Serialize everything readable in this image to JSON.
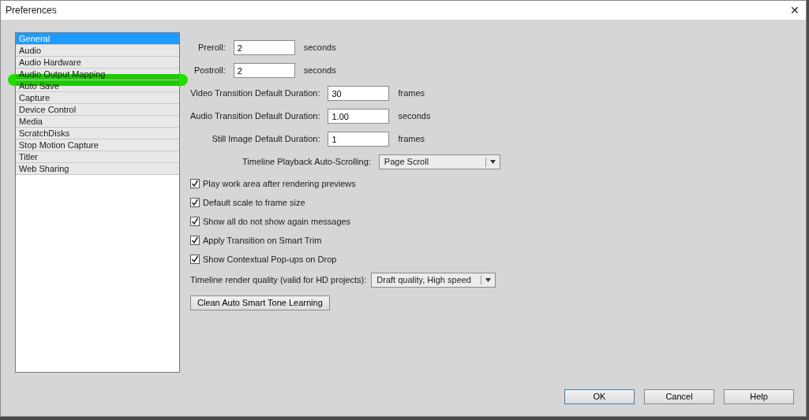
{
  "window": {
    "title": "Preferences",
    "close": "✕"
  },
  "sidebar": {
    "items": [
      {
        "label": "General",
        "selected": true,
        "highlighted": false
      },
      {
        "label": "Audio",
        "selected": false,
        "highlighted": false
      },
      {
        "label": "Audio Hardware",
        "selected": false,
        "highlighted": false
      },
      {
        "label": "Audio Output Mapping",
        "selected": false,
        "highlighted": true
      },
      {
        "label": "Auto Save",
        "selected": false,
        "highlighted": false
      },
      {
        "label": "Capture",
        "selected": false,
        "highlighted": false
      },
      {
        "label": "Device Control",
        "selected": false,
        "highlighted": false
      },
      {
        "label": "Media",
        "selected": false,
        "highlighted": false
      },
      {
        "label": "ScratchDisks",
        "selected": false,
        "highlighted": false
      },
      {
        "label": "Stop Motion Capture",
        "selected": false,
        "highlighted": false
      },
      {
        "label": "Titler",
        "selected": false,
        "highlighted": false
      },
      {
        "label": "Web Sharing",
        "selected": false,
        "highlighted": false
      }
    ]
  },
  "field_groups": [
    {
      "fields": [
        {
          "kind": "text",
          "label": "Preroll:",
          "value": "2",
          "unit": "seconds"
        },
        {
          "kind": "text",
          "label": "Postroll:",
          "value": "2",
          "unit": "seconds"
        }
      ]
    },
    {
      "fields": [
        {
          "kind": "text",
          "label": "Video Transition Default Duration:",
          "value": "30",
          "unit": "frames"
        },
        {
          "kind": "text",
          "label": "Audio Transition Default Duration:",
          "value": "1.00",
          "unit": "seconds"
        },
        {
          "kind": "text",
          "label": "Still Image Default Duration:",
          "value": "1",
          "unit": "frames"
        }
      ]
    },
    {
      "fields": [
        {
          "kind": "select",
          "label": "Timeline Playback Auto-Scrolling:",
          "value": "Page Scroll"
        }
      ]
    }
  ],
  "checkboxes": [
    {
      "label": "Play work area after rendering previews",
      "checked": true
    },
    {
      "label": "Default scale to frame size",
      "checked": true
    },
    {
      "label": "Show all do not show again messages",
      "checked": true
    },
    {
      "label": "Apply Transition on Smart Trim",
      "checked": true
    },
    {
      "label": "Show Contextual Pop-ups on Drop",
      "checked": true
    }
  ],
  "render_quality": {
    "label": "Timeline render quality (valid for HD projects):",
    "value": "Draft quality, High speed"
  },
  "action_button": "Clean Auto Smart Tone Learning",
  "buttons": [
    {
      "label": "OK",
      "default": true
    },
    {
      "label": "Cancel",
      "default": false
    },
    {
      "label": "Help",
      "default": false
    }
  ]
}
